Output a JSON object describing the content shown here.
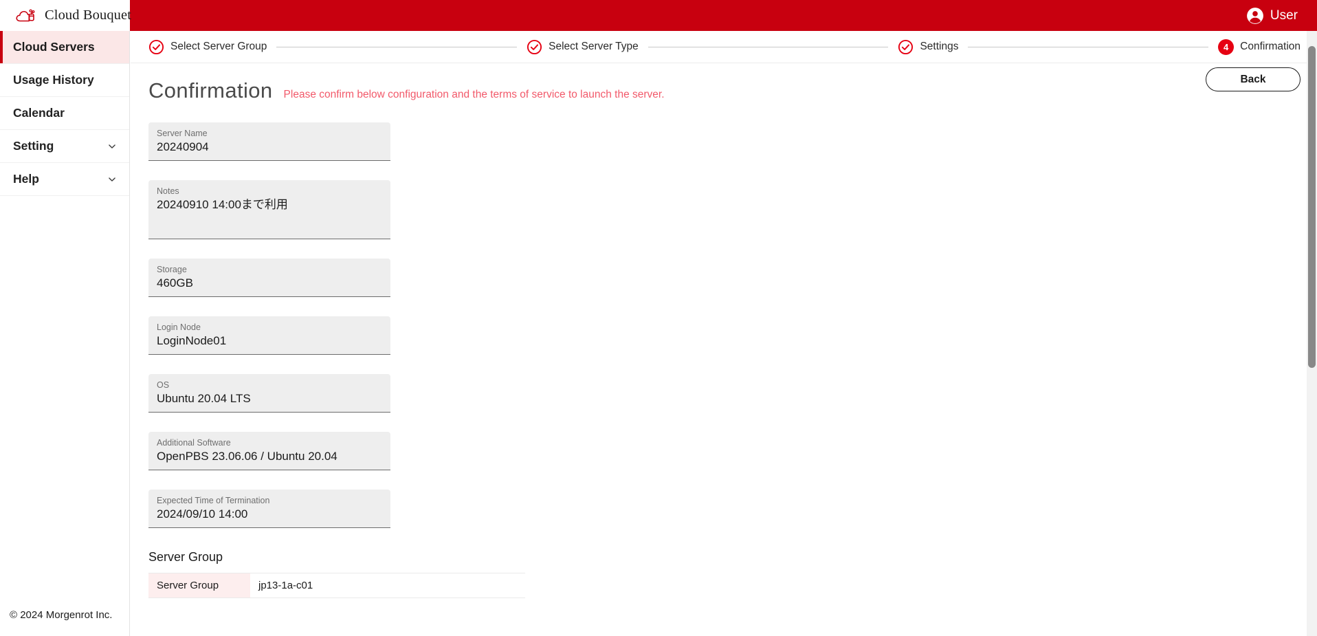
{
  "brand": {
    "name": "Cloud Bouquet",
    "logo_icon": "cloud-bouquet-logo-icon",
    "menu_icon": "hamburger-menu-icon"
  },
  "topbar": {
    "background": "#c8000f",
    "user_label": "User",
    "user_icon": "account-circle-icon"
  },
  "sidebar": {
    "items": [
      {
        "label": "Cloud Servers",
        "active": true,
        "expandable": false
      },
      {
        "label": "Usage History",
        "active": false,
        "expandable": false
      },
      {
        "label": "Calendar",
        "active": false,
        "expandable": false
      },
      {
        "label": "Setting",
        "active": false,
        "expandable": true,
        "icon": "chevron-down-icon"
      },
      {
        "label": "Help",
        "active": false,
        "expandable": true,
        "icon": "chevron-down-icon"
      }
    ],
    "footer": "© 2024 Morgenrot Inc.",
    "active_accent": "#c8000f",
    "active_background": "#fbe7e7"
  },
  "stepper": {
    "steps": [
      {
        "number": "1",
        "label": "Select Server Group",
        "state": "done",
        "icon": "check-circle-icon"
      },
      {
        "number": "2",
        "label": "Select Server Type",
        "state": "done",
        "icon": "check-circle-icon"
      },
      {
        "number": "3",
        "label": "Settings",
        "state": "done",
        "icon": "check-circle-icon"
      },
      {
        "number": "4",
        "label": "Confirmation",
        "state": "current",
        "icon": "number-badge"
      }
    ],
    "accent": "#e60012"
  },
  "page": {
    "title": "Confirmation",
    "subtitle": "Please confirm below configuration and the terms of service to launch the server.",
    "subtitle_color": "#f2596a",
    "back_label": "Back"
  },
  "fields": [
    {
      "label": "Server Name",
      "value": "20240904",
      "tall": false
    },
    {
      "label": "Notes",
      "value": "20240910 14:00まで利用",
      "tall": true
    },
    {
      "label": "Storage",
      "value": "460GB",
      "tall": false
    },
    {
      "label": "Login Node",
      "value": "LoginNode01",
      "tall": false
    },
    {
      "label": "OS",
      "value": "Ubuntu 20.04 LTS",
      "tall": false
    },
    {
      "label": "Additional Software",
      "value": "OpenPBS 23.06.06 / Ubuntu 20.04",
      "tall": false
    },
    {
      "label": "Expected Time of Termination",
      "value": "2024/09/10 14:00",
      "tall": false
    }
  ],
  "server_group": {
    "heading": "Server Group",
    "rows": [
      {
        "key": "Server Group",
        "value": "jp13-1a-c01"
      }
    ]
  },
  "scrollbar": {
    "position": "right",
    "thumb_top_pct": 2,
    "thumb_height_pct": 53
  }
}
